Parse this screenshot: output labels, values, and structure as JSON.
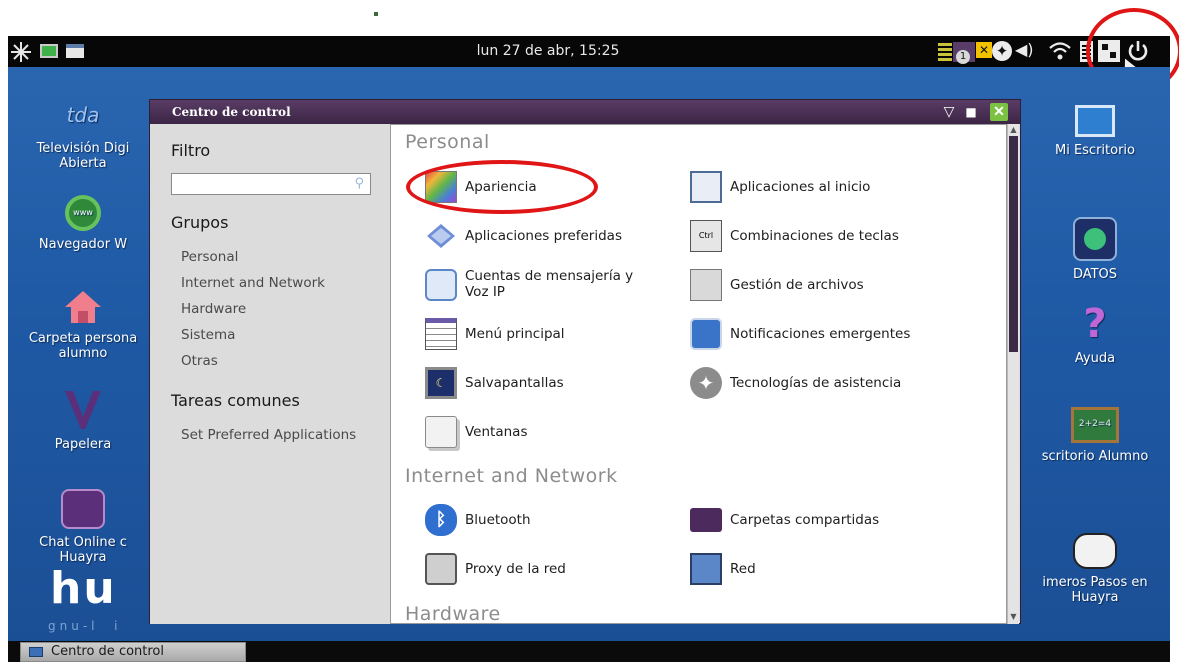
{
  "topbar": {
    "clock": "lun 27 de abr, 15:25",
    "left_icons": [
      "spark-icon",
      "monitor-icon",
      "window-icon"
    ],
    "tray_icons": [
      "app-indicator-icon",
      "notification-icon",
      "accessibility-icon",
      "volume-icon",
      "wifi-icon",
      "battery-icon",
      "network-icon",
      "power-icon"
    ],
    "badge_number": "1"
  },
  "desktop": {
    "left_icons": [
      {
        "label": "Televisión Digi\nAbierta",
        "logo": "tda"
      },
      {
        "label": "Navegador W",
        "logo": "www"
      },
      {
        "label": "Carpeta persona\nalumno",
        "logo": ""
      },
      {
        "label": "Papelera",
        "logo": ""
      },
      {
        "label": "Chat Online c\nHuayra",
        "logo": ""
      }
    ],
    "right_icons": [
      {
        "label": "Mi Escritorio"
      },
      {
        "label": "DATOS"
      },
      {
        "label": "Ayuda"
      },
      {
        "label": "scritorio Alumno",
        "board_text": "2+2=4"
      },
      {
        "label": "imeros Pasos en\nHuayra"
      }
    ],
    "brand": "hu",
    "brand_sub": "gnu-l  i"
  },
  "window": {
    "title": "Centro de control",
    "buttons": {
      "menu": "▽",
      "maximize": "■",
      "close": "✕"
    },
    "sidebar": {
      "filter_heading": "Filtro",
      "search_value": "",
      "groups_heading": "Grupos",
      "groups": [
        "Personal",
        "Internet and Network",
        "Hardware",
        "Sistema",
        "Otras"
      ],
      "tasks_heading": "Tareas comunes",
      "tasks": [
        "Set Preferred Applications"
      ]
    },
    "sections": [
      {
        "heading": "Personal",
        "items": [
          {
            "label": "Apariencia",
            "icon": "appearance-icon"
          },
          {
            "label": "Aplicaciones al inicio",
            "icon": "startup-apps-icon"
          },
          {
            "label": "Aplicaciones preferidas",
            "icon": "preferred-apps-icon"
          },
          {
            "label": "Combinaciones de teclas",
            "icon": "keyboard-shortcuts-icon"
          },
          {
            "label": "Cuentas de mensajería y\nVoz IP",
            "icon": "messaging-icon"
          },
          {
            "label": "Gestión de archivos",
            "icon": "file-management-icon"
          },
          {
            "label": "Menú principal",
            "icon": "main-menu-icon"
          },
          {
            "label": "Notificaciones emergentes",
            "icon": "notifications-icon"
          },
          {
            "label": "Salvapantallas",
            "icon": "screensaver-icon"
          },
          {
            "label": "Tecnologías de asistencia",
            "icon": "accessibility-icon"
          },
          {
            "label": "Ventanas",
            "icon": "windows-icon"
          }
        ]
      },
      {
        "heading": "Internet and Network",
        "items": [
          {
            "label": "Bluetooth",
            "icon": "bluetooth-icon"
          },
          {
            "label": "Carpetas compartidas",
            "icon": "shared-folders-icon"
          },
          {
            "label": "Proxy de la red",
            "icon": "proxy-icon"
          },
          {
            "label": "Red",
            "icon": "network-icon"
          }
        ]
      },
      {
        "heading": "Hardware",
        "items": []
      }
    ]
  },
  "taskbar": {
    "task_label": "Centro de control"
  },
  "colors": {
    "titlebar": "#4a3055",
    "desktop": "#1f5aa6",
    "highlight_ring": "#e01515"
  }
}
